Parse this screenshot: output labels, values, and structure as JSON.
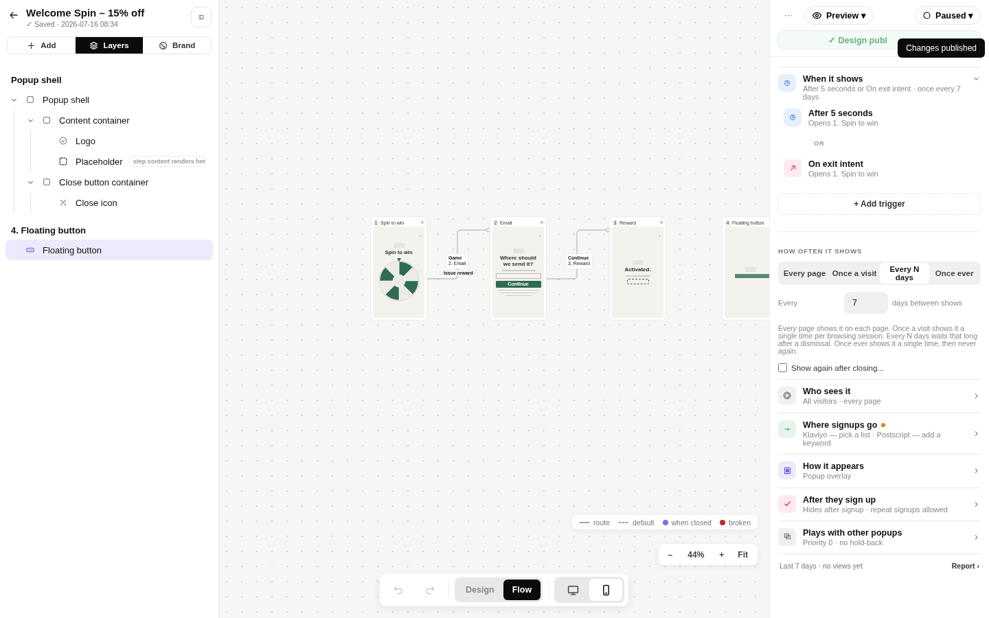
{
  "editor": {
    "title": "Welcome Spin – 15% off",
    "saved": "✓ Saved · 2026-07-16 08:34"
  },
  "tabs": [
    {
      "label": "Add",
      "kind": "add",
      "selected": false
    },
    {
      "label": "Layers",
      "kind": "layers",
      "selected": true
    },
    {
      "label": "Brand",
      "kind": "brand",
      "selected": false
    }
  ],
  "layer_sections": [
    {
      "title": "Popup shell",
      "items": [
        {
          "label": "Popup shell",
          "kind": "box",
          "expanded": true,
          "selected": false,
          "children": [
            {
              "label": "Content container",
              "kind": "box",
              "expanded": true,
              "selected": false,
              "children": [
                {
                  "label": "Logo",
                  "kind": "logo",
                  "selected": false
                },
                {
                  "label": "Placeholder",
                  "kind": "placeholder",
                  "selected": false,
                  "badge": "step content renders her"
                }
              ]
            },
            {
              "label": "Close button container",
              "kind": "box",
              "expanded": true,
              "selected": false,
              "children": [
                {
                  "label": "Close icon",
                  "kind": "close",
                  "selected": false
                }
              ]
            }
          ]
        }
      ]
    },
    {
      "title": "4. Floating button",
      "items": [
        {
          "label": "Floating button",
          "kind": "pill",
          "selected": true
        }
      ]
    }
  ],
  "flow": {
    "nodes": [
      {
        "number": "1",
        "title": "Spin to win",
        "kind": "wheel",
        "heading": "Spin to win"
      },
      {
        "number": "2",
        "title": "Email",
        "kind": "form",
        "heading": "Where should we send it?",
        "button": "Continue"
      },
      {
        "number": "3",
        "title": "Reward",
        "kind": "reward",
        "heading": "Activated."
      },
      {
        "number": "4",
        "title": "Floating button",
        "kind": "floating"
      }
    ],
    "edges": [
      {
        "label": "Game",
        "target": "2. Email",
        "note": "Issue reward"
      },
      {
        "label": "Continue",
        "target": "3. Reward"
      }
    ]
  },
  "legend": [
    {
      "label": "route",
      "kind": "line"
    },
    {
      "label": "default",
      "kind": "dashed"
    },
    {
      "label": "when closed",
      "kind": "dot",
      "color": "#7b6cf2"
    },
    {
      "label": "broken",
      "kind": "dot",
      "color": "#c62828"
    }
  ],
  "zoom": {
    "minus": "–",
    "value": "44%",
    "plus": "+",
    "fit": "Fit"
  },
  "toolbar": {
    "undo_disabled": true,
    "redo_disabled": true,
    "modes": [
      {
        "label": "Design",
        "selected": false
      },
      {
        "label": "Flow",
        "selected": true
      }
    ],
    "devices": [
      {
        "kind": "desktop",
        "selected": false
      },
      {
        "kind": "mobile",
        "selected": true
      }
    ]
  },
  "top_bar": {
    "more": "···",
    "preview": "Preview ▾",
    "status": "Paused ▾"
  },
  "banner": {
    "text": "✓ Design publ",
    "tooltip": "Changes published"
  },
  "when_it_shows": {
    "title": "When it shows",
    "summary": "After 5 seconds or On exit intent · once every 7 days",
    "expanded": true,
    "triggers": [
      {
        "title": "After 5 seconds",
        "detail": "Opens 1. Spin to win",
        "kind": "timer"
      },
      {
        "title": "On exit intent",
        "detail": "Opens 1. Spin to win",
        "kind": "exit"
      }
    ],
    "separator": "OR",
    "add": "+ Add trigger"
  },
  "frequency": {
    "heading": "HOW OFTEN IT SHOWS",
    "options": [
      {
        "label": "Every page",
        "selected": false
      },
      {
        "label": "Once a visit",
        "selected": false
      },
      {
        "label": "Every N days",
        "selected": true
      },
      {
        "label": "Once ever",
        "selected": false
      }
    ],
    "every_label": "Every",
    "days_value": "7",
    "days_suffix": "days between shows",
    "help": "Every page shows it on each page. Once a visit shows it a single time per browsing session. Every N days waits that long after a dismissal. Once ever shows it a single time, then never again.",
    "show_again": {
      "label": "Show again after closing...",
      "checked": false
    }
  },
  "settings": [
    {
      "title": "Who sees it",
      "detail": "All visitors · every page",
      "kind": "audience"
    },
    {
      "title": "Where signups go",
      "detail": "Klaviyo — pick a list · Postscript — add a keyword",
      "kind": "destination",
      "color": "#d4881c"
    },
    {
      "title": "How it appears",
      "detail": "Popup overlay",
      "kind": "appearance"
    },
    {
      "title": "After they sign up",
      "detail": "Hides after signup · repeat signups allowed",
      "kind": "after"
    },
    {
      "title": "Plays with other popups",
      "detail": "Priority 0 · no hold-back",
      "kind": "stacking"
    }
  ],
  "footer": {
    "stats": "Last 7 days · no views yet",
    "report": "Report ›"
  }
}
